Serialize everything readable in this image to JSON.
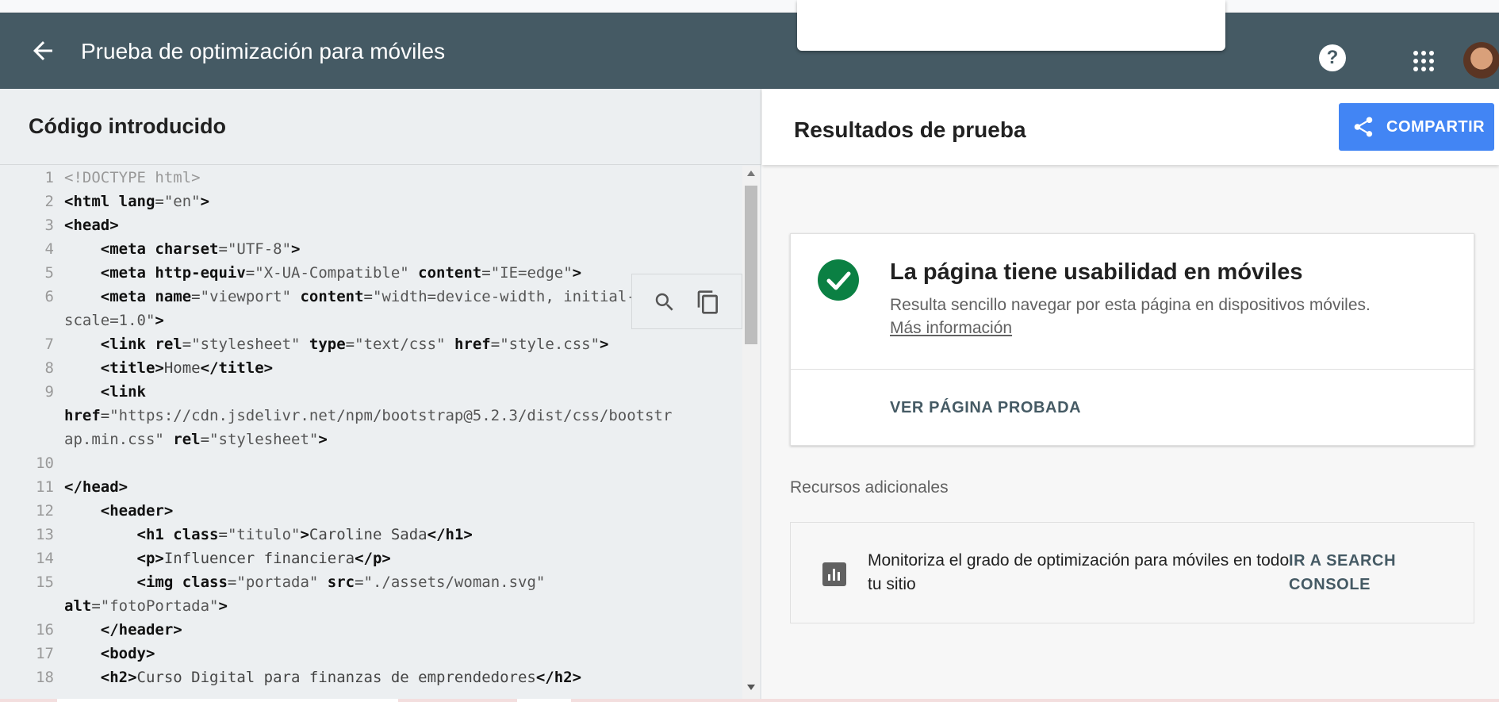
{
  "appbar": {
    "title": "Prueba de optimización para móviles",
    "help_label": "?"
  },
  "left": {
    "title": "Código introducido"
  },
  "code_lines": [
    {
      "n": "1",
      "parts": [
        {
          "c": "dt",
          "t": "<!DOCTYPE html>"
        }
      ]
    },
    {
      "n": "2",
      "parts": [
        {
          "c": "tg",
          "t": "<html "
        },
        {
          "c": "at",
          "t": "lang"
        },
        {
          "c": "tx",
          "t": "="
        },
        {
          "c": "st",
          "t": "\"en\""
        },
        {
          "c": "tg",
          "t": ">"
        }
      ]
    },
    {
      "n": "3",
      "parts": [
        {
          "c": "tg",
          "t": "<head>"
        }
      ]
    },
    {
      "n": "4",
      "parts": [
        {
          "c": "tx",
          "t": "    "
        },
        {
          "c": "tg",
          "t": "<meta "
        },
        {
          "c": "at",
          "t": "charset"
        },
        {
          "c": "tx",
          "t": "="
        },
        {
          "c": "st",
          "t": "\"UTF-8\""
        },
        {
          "c": "tg",
          "t": ">"
        }
      ]
    },
    {
      "n": "5",
      "parts": [
        {
          "c": "tx",
          "t": "    "
        },
        {
          "c": "tg",
          "t": "<meta "
        },
        {
          "c": "at",
          "t": "http-equiv"
        },
        {
          "c": "tx",
          "t": "="
        },
        {
          "c": "st",
          "t": "\"X-UA-Compatible\" "
        },
        {
          "c": "at",
          "t": "content"
        },
        {
          "c": "tx",
          "t": "="
        },
        {
          "c": "st",
          "t": "\"IE=edge\""
        },
        {
          "c": "tg",
          "t": ">"
        }
      ]
    },
    {
      "n": "6",
      "parts": [
        {
          "c": "tx",
          "t": "    "
        },
        {
          "c": "tg",
          "t": "<meta "
        },
        {
          "c": "at",
          "t": "name"
        },
        {
          "c": "tx",
          "t": "="
        },
        {
          "c": "st",
          "t": "\"viewport\" "
        },
        {
          "c": "at",
          "t": "content"
        },
        {
          "c": "tx",
          "t": "="
        },
        {
          "c": "st",
          "t": "\"width=device-width, initial-"
        }
      ]
    },
    {
      "n": "",
      "parts": [
        {
          "c": "st",
          "t": "scale=1.0\""
        },
        {
          "c": "tg",
          "t": ">"
        }
      ]
    },
    {
      "n": "7",
      "parts": [
        {
          "c": "tx",
          "t": "    "
        },
        {
          "c": "tg",
          "t": "<link "
        },
        {
          "c": "at",
          "t": "rel"
        },
        {
          "c": "tx",
          "t": "="
        },
        {
          "c": "st",
          "t": "\"stylesheet\" "
        },
        {
          "c": "at",
          "t": "type"
        },
        {
          "c": "tx",
          "t": "="
        },
        {
          "c": "st",
          "t": "\"text/css\" "
        },
        {
          "c": "at",
          "t": "href"
        },
        {
          "c": "tx",
          "t": "="
        },
        {
          "c": "st",
          "t": "\"style.css\""
        },
        {
          "c": "tg",
          "t": ">"
        }
      ]
    },
    {
      "n": "8",
      "parts": [
        {
          "c": "tx",
          "t": "    "
        },
        {
          "c": "tg",
          "t": "<title>"
        },
        {
          "c": "tx",
          "t": "Home"
        },
        {
          "c": "tg",
          "t": "</title>"
        }
      ]
    },
    {
      "n": "9",
      "parts": [
        {
          "c": "tx",
          "t": "    "
        },
        {
          "c": "tg",
          "t": "<link"
        }
      ]
    },
    {
      "n": "",
      "parts": [
        {
          "c": "at",
          "t": "href"
        },
        {
          "c": "tx",
          "t": "="
        },
        {
          "c": "st",
          "t": "\"https://cdn.jsdelivr.net/npm/bootstrap@5.2.3/dist/css/bootstr"
        }
      ]
    },
    {
      "n": "",
      "parts": [
        {
          "c": "st",
          "t": "ap.min.css\" "
        },
        {
          "c": "at",
          "t": "rel"
        },
        {
          "c": "tx",
          "t": "="
        },
        {
          "c": "st",
          "t": "\"stylesheet\""
        },
        {
          "c": "tg",
          "t": ">"
        }
      ]
    },
    {
      "n": "10",
      "parts": [
        {
          "c": "tx",
          "t": ""
        }
      ]
    },
    {
      "n": "11",
      "parts": [
        {
          "c": "tg",
          "t": "</head>"
        }
      ]
    },
    {
      "n": "12",
      "parts": [
        {
          "c": "tx",
          "t": "    "
        },
        {
          "c": "tg",
          "t": "<header>"
        }
      ]
    },
    {
      "n": "13",
      "parts": [
        {
          "c": "tx",
          "t": "        "
        },
        {
          "c": "tg",
          "t": "<h1 "
        },
        {
          "c": "at",
          "t": "class"
        },
        {
          "c": "tx",
          "t": "="
        },
        {
          "c": "st",
          "t": "\"titulo\""
        },
        {
          "c": "tg",
          "t": ">"
        },
        {
          "c": "tx",
          "t": "Caroline Sada"
        },
        {
          "c": "tg",
          "t": "</h1>"
        }
      ]
    },
    {
      "n": "14",
      "parts": [
        {
          "c": "tx",
          "t": "        "
        },
        {
          "c": "tg",
          "t": "<p>"
        },
        {
          "c": "tx",
          "t": "Influencer financiera"
        },
        {
          "c": "tg",
          "t": "</p>"
        }
      ]
    },
    {
      "n": "15",
      "parts": [
        {
          "c": "tx",
          "t": "        "
        },
        {
          "c": "tg",
          "t": "<img "
        },
        {
          "c": "at",
          "t": "class"
        },
        {
          "c": "tx",
          "t": "="
        },
        {
          "c": "st",
          "t": "\"portada\" "
        },
        {
          "c": "at",
          "t": "src"
        },
        {
          "c": "tx",
          "t": "="
        },
        {
          "c": "st",
          "t": "\"./assets/woman.svg\""
        }
      ]
    },
    {
      "n": "",
      "parts": [
        {
          "c": "at",
          "t": "alt"
        },
        {
          "c": "tx",
          "t": "="
        },
        {
          "c": "st",
          "t": "\"fotoPortada\""
        },
        {
          "c": "tg",
          "t": ">"
        }
      ]
    },
    {
      "n": "16",
      "parts": [
        {
          "c": "tx",
          "t": "    "
        },
        {
          "c": "tg",
          "t": "</header>"
        }
      ]
    },
    {
      "n": "17",
      "parts": [
        {
          "c": "tx",
          "t": "    "
        },
        {
          "c": "tg",
          "t": "<body>"
        }
      ]
    },
    {
      "n": "18",
      "parts": [
        {
          "c": "tx",
          "t": "    "
        },
        {
          "c": "tg",
          "t": "<h2>"
        },
        {
          "c": "tx",
          "t": "Curso Digital para finanzas de emprendedores"
        },
        {
          "c": "tg",
          "t": "</h2>"
        }
      ]
    }
  ],
  "right": {
    "title": "Resultados de prueba",
    "share_label": "COMPARTIR",
    "result": {
      "title": "La página tiene usabilidad en móviles",
      "description": "Resulta sencillo navegar por esta página en dispositivos móviles.",
      "link": "Más información",
      "view_page": "VER PÁGINA PROBADA"
    },
    "resources": {
      "label": "Recursos adicionales",
      "text": "Monitoriza el grado de optimización para móviles en todo tu sitio",
      "link": "IR A SEARCH CONSOLE"
    }
  },
  "colors": {
    "appbar": "#455a64",
    "accent": "#4285f4",
    "success": "#0b8043"
  },
  "icons": [
    "back-arrow-icon",
    "help-icon",
    "apps-grid-icon",
    "search-icon",
    "copy-icon",
    "share-icon",
    "check-icon",
    "bar-chart-icon"
  ]
}
